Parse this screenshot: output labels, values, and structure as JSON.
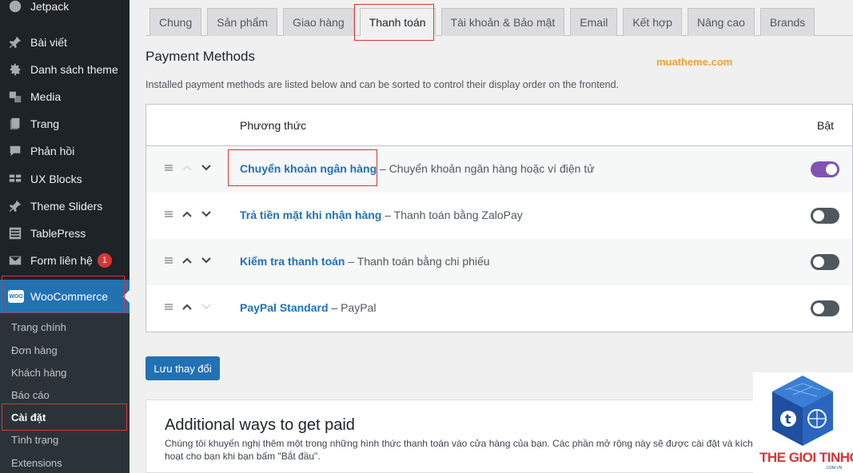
{
  "sidebar": {
    "items": [
      {
        "label": "Jetpack",
        "icon": "jetpack-icon"
      },
      {
        "label": "Bài viết",
        "icon": "pin-icon"
      },
      {
        "label": "Danh sách theme",
        "icon": "gear-icon"
      },
      {
        "label": "Media",
        "icon": "media-icon"
      },
      {
        "label": "Trang",
        "icon": "page-icon"
      },
      {
        "label": "Phản hồi",
        "icon": "comment-icon"
      },
      {
        "label": "UX Blocks",
        "icon": "blocks-icon"
      },
      {
        "label": "Theme Sliders",
        "icon": "pin-icon"
      },
      {
        "label": "TablePress",
        "icon": "table-icon"
      },
      {
        "label": "Form liên hệ",
        "icon": "mail-icon",
        "badge": "1"
      }
    ],
    "woocommerce": {
      "label": "WooCommerce",
      "logo_text": "WOO"
    },
    "submenu": [
      {
        "label": "Trang chính"
      },
      {
        "label": "Đơn hàng"
      },
      {
        "label": "Khách hàng"
      },
      {
        "label": "Báo cáo"
      },
      {
        "label": "Cài đặt",
        "current": true
      },
      {
        "label": "Tình trạng"
      },
      {
        "label": "Extensions"
      }
    ]
  },
  "tabs": [
    {
      "label": "Chung"
    },
    {
      "label": "Sản phẩm"
    },
    {
      "label": "Giao hàng"
    },
    {
      "label": "Thanh toán",
      "active": true
    },
    {
      "label": "Tài khoản & Bảo mật"
    },
    {
      "label": "Email"
    },
    {
      "label": "Kết hợp"
    },
    {
      "label": "Nâng cao"
    },
    {
      "label": "Brands"
    }
  ],
  "payment": {
    "title": "Payment Methods",
    "watermark": "muatheme.com",
    "description": "Installed payment methods are listed below and can be sorted to control their display order on the frontend.",
    "columns": {
      "method": "Phương thức",
      "enabled": "Bật"
    },
    "methods": [
      {
        "name": "Chuyển khoản ngân hàng",
        "desc": " – Chuyển khoản ngân hàng hoặc ví điện tử",
        "enabled": true
      },
      {
        "name": "Trả tiền mặt khi nhận hàng",
        "desc": " – Thanh toán bằng ZaloPay",
        "enabled": false
      },
      {
        "name": "Kiểm tra thanh toán",
        "desc": " – Thanh toán bằng chi phiếu",
        "enabled": false
      },
      {
        "name": "PayPal Standard",
        "desc": " – PayPal",
        "enabled": false
      }
    ]
  },
  "save_button": "Lưu thay đổi",
  "additional": {
    "title": "Additional ways to get paid",
    "description": "Chúng tôi khuyến nghị thêm một trong những hình thức thanh toán vào cửa hàng của bạn. Các phần mở rộng này sẽ được cài đặt và kích hoạt cho bạn khi bạn bấm \"Bắt đầu\"."
  },
  "brand": {
    "name": "THE GIOI TINHOC",
    "sub": ".COM.VN"
  },
  "colors": {
    "accent": "#2271b1",
    "toggle_on": "#7f54b3",
    "highlight": "#d63638",
    "watermark": "#f0a13a"
  }
}
